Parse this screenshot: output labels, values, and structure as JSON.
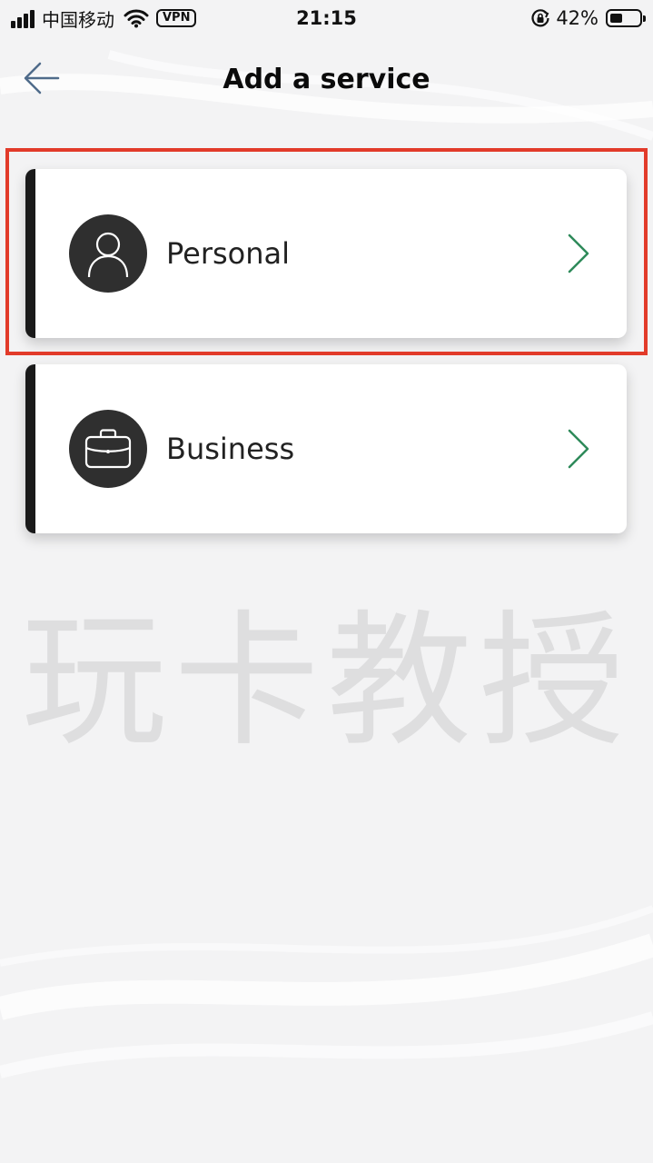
{
  "status_bar": {
    "carrier": "中国移动",
    "vpn": "VPN",
    "time": "21:15",
    "battery_percent": "42%",
    "battery_level": 0.42,
    "icons": [
      "signal-icon",
      "wifi-icon",
      "rotation-lock-icon",
      "battery-icon"
    ]
  },
  "header": {
    "title": "Add a service",
    "back_icon": "arrow-left-icon"
  },
  "services": [
    {
      "label": "Personal",
      "icon": "person-icon",
      "highlighted": true
    },
    {
      "label": "Business",
      "icon": "briefcase-icon",
      "highlighted": false
    }
  ],
  "watermark": "玩卡教授",
  "colors": {
    "background": "#f3f3f4",
    "card": "#ffffff",
    "accent_bar": "#1a1a1a",
    "icon_circle": "#2f2f2f",
    "chevron": "#2e8a5a",
    "highlight": "#e23b2a",
    "back_arrow": "#4f6b8a"
  }
}
